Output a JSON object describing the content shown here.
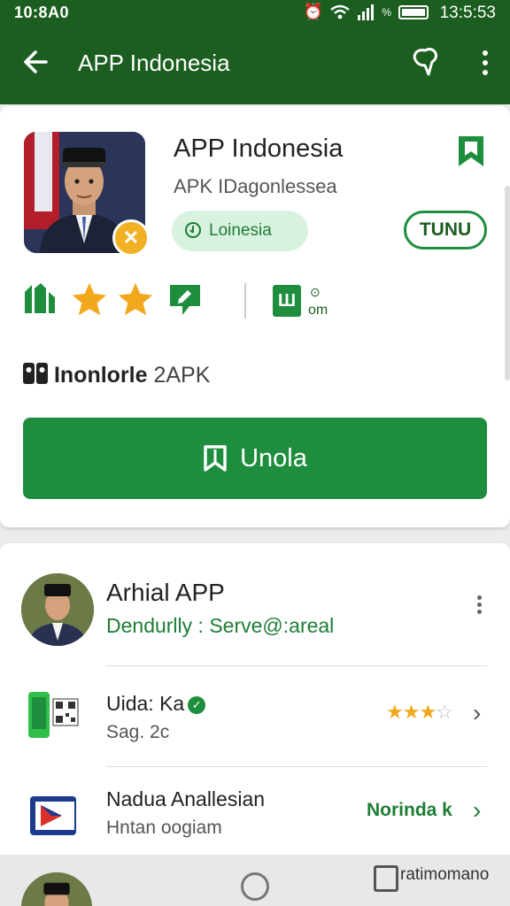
{
  "status_bar": {
    "time_left": "10:8A0",
    "battery_pct": "%",
    "time_right": "13:5:53"
  },
  "app_bar": {
    "title": "APP Indonesia"
  },
  "app": {
    "name": "APP Indonesia",
    "subtitle": "APK IDagonlessea",
    "chip_label": "Loinesia",
    "turn_label": "TUNU",
    "stat_label": "om",
    "developer_bold": "Inonlorle",
    "developer_rest": " 2APK",
    "install_label": "Unola"
  },
  "developer": {
    "name": "Arhial APP",
    "email": "Dendurlly : Serve@:areal"
  },
  "rows": [
    {
      "title": "Uida: Ka",
      "subtitle": "Sag. 2c",
      "rating": 3,
      "rating_max": 5
    },
    {
      "title": "Nadua Anallesian",
      "subtitle": "Hntan oogiam",
      "link": "Norinda k"
    }
  ],
  "bottom_nav": {
    "label": "ratimomano"
  },
  "colors": {
    "primary": "#1b5e20",
    "accent": "#1e8e3e",
    "star": "#f2a81d"
  }
}
